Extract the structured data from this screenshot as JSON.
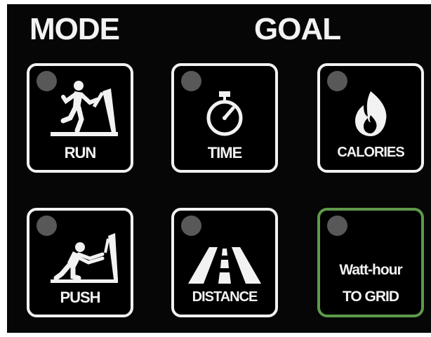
{
  "headings": {
    "mode": "MODE",
    "goal": "GOAL"
  },
  "buttons": {
    "run": {
      "label": "RUN"
    },
    "time": {
      "label": "TIME"
    },
    "calories": {
      "label": "CALORIES"
    },
    "push": {
      "label": "PUSH"
    },
    "distance": {
      "label": "DISTANCE"
    },
    "watt_hour": {
      "label_line1": "Watt-hour",
      "label_line2": "TO GRID"
    }
  },
  "colors": {
    "background": "#060606",
    "foreground": "#f2f2f2",
    "indicator_off": "#585858",
    "highlight_border": "#5e9a4a"
  },
  "icons": {
    "run": "treadmill-runner-icon",
    "time": "stopwatch-icon",
    "calories": "flame-icon",
    "push": "treadmill-push-icon",
    "distance": "road-icon"
  }
}
